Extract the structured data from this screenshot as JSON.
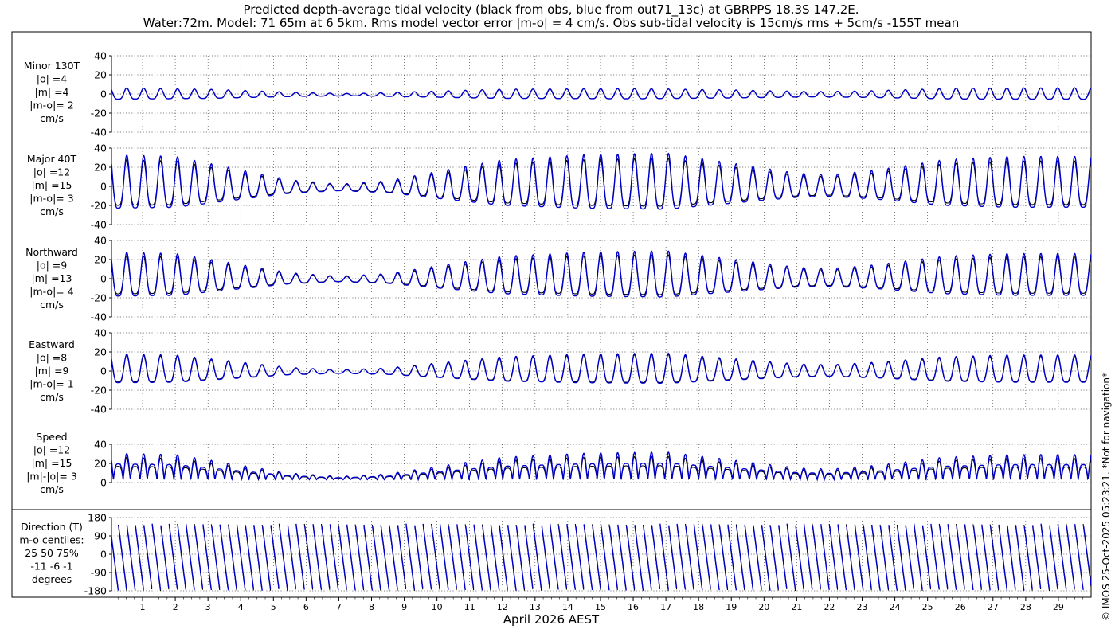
{
  "title": {
    "line1": "Predicted depth-average tidal velocity (black from obs, blue from out71_13c) at GBRPPS 18.3S 147.2E.",
    "line2": "Water:72m. Model: 71 65m at 6 5km. Rms model vector error |m-o| = 4 cm/s. Obs sub-tidal velocity is 15cm/s rms + 5cm/s -155T mean"
  },
  "xlabel": "April 2026 AEST",
  "credit": "© IMOS 25-Oct-2025 05:23:21. *Not for navigation*",
  "colors": {
    "obs": "#000000",
    "model": "#0000cc",
    "grid": "#000000"
  },
  "chart_data": {
    "type": "line",
    "x_ticks": [
      "1",
      "2",
      "3",
      "4",
      "5",
      "6",
      "7",
      "8",
      "9",
      "10",
      "11",
      "12",
      "13",
      "14",
      "15",
      "16",
      "17",
      "18",
      "19",
      "20",
      "21",
      "22",
      "23",
      "24",
      "25",
      "26",
      "27",
      "28",
      "29"
    ],
    "xlim": [
      0.05,
      30.0
    ],
    "series_legend": {
      "obs": "black from obs",
      "model": "blue from out71_13c"
    },
    "panels": [
      {
        "id": "minor",
        "label": [
          "Minor 130T",
          "|o| =4",
          "|m| =4",
          "|m-o|= 2",
          "cm/s"
        ],
        "ylim": [
          -40,
          40
        ],
        "yticks": [
          "40",
          "20",
          "0",
          "-20",
          "-40"
        ],
        "yvals": [
          40,
          20,
          0,
          -20,
          -40
        ],
        "kind": "tidal",
        "obs_amp": 6,
        "model_amp": 6,
        "offset": -1,
        "amp_envelope": [
          [
            0,
            1.0
          ],
          [
            3,
            0.8
          ],
          [
            6,
            0.3
          ],
          [
            7.5,
            0.2
          ],
          [
            9,
            0.4
          ],
          [
            12,
            0.8
          ],
          [
            16,
            0.9
          ],
          [
            19,
            0.7
          ],
          [
            21.5,
            0.45
          ],
          [
            23,
            0.55
          ],
          [
            26,
            0.95
          ],
          [
            30,
            1.0
          ]
        ]
      },
      {
        "id": "major",
        "label": [
          "Major 40T",
          "|o| =12",
          "|m| =15",
          "|m-o|= 3",
          "cm/s"
        ],
        "ylim": [
          -40,
          40
        ],
        "yticks": [
          "40",
          "20",
          "0",
          "-20",
          "-40"
        ],
        "yvals": [
          40,
          20,
          0,
          -20,
          -40
        ],
        "kind": "tidal",
        "obs_amp": 24,
        "model_amp": 28,
        "offset": -2,
        "amp_envelope": [
          [
            0,
            1.0
          ],
          [
            2,
            0.95
          ],
          [
            4,
            0.55
          ],
          [
            5.5,
            0.25
          ],
          [
            7,
            0.12
          ],
          [
            8.5,
            0.22
          ],
          [
            10,
            0.5
          ],
          [
            12,
            0.85
          ],
          [
            14.5,
            1.0
          ],
          [
            17,
            1.05
          ],
          [
            19,
            0.75
          ],
          [
            21,
            0.45
          ],
          [
            22,
            0.4
          ],
          [
            23.5,
            0.55
          ],
          [
            25.5,
            0.85
          ],
          [
            27.5,
            0.95
          ],
          [
            30,
            0.95
          ]
        ]
      },
      {
        "id": "northward",
        "label": [
          "Northward",
          "|o| =9",
          "|m| =13",
          "|m-o|= 4",
          "cm/s"
        ],
        "ylim": [
          -40,
          40
        ],
        "yticks": [
          "40",
          "20",
          "0",
          "-20",
          "-40"
        ],
        "yvals": [
          40,
          20,
          0,
          -20,
          -40
        ],
        "kind": "tidal",
        "obs_amp": 20,
        "model_amp": 23,
        "offset": -1,
        "amp_envelope": [
          [
            0,
            1.0
          ],
          [
            2,
            0.95
          ],
          [
            4,
            0.55
          ],
          [
            5.5,
            0.25
          ],
          [
            7,
            0.12
          ],
          [
            8.5,
            0.22
          ],
          [
            10,
            0.5
          ],
          [
            12,
            0.85
          ],
          [
            14.5,
            1.0
          ],
          [
            17,
            1.05
          ],
          [
            19,
            0.75
          ],
          [
            21,
            0.45
          ],
          [
            22,
            0.4
          ],
          [
            23.5,
            0.55
          ],
          [
            25.5,
            0.85
          ],
          [
            27.5,
            0.95
          ],
          [
            30,
            0.95
          ]
        ]
      },
      {
        "id": "eastward",
        "label": [
          "Eastward",
          "|o| =8",
          "|m| =9",
          "|m-o|= 1",
          "cm/s"
        ],
        "ylim": [
          -40,
          40
        ],
        "yticks": [
          "40",
          "20",
          "0",
          "-20",
          "-40"
        ],
        "yvals": [
          40,
          20,
          0,
          -20,
          -40
        ],
        "kind": "tidal",
        "obs_amp": 14,
        "model_amp": 15,
        "offset": -1,
        "amp_envelope": [
          [
            0,
            1.0
          ],
          [
            2,
            0.95
          ],
          [
            4,
            0.55
          ],
          [
            5.5,
            0.25
          ],
          [
            7,
            0.12
          ],
          [
            8.5,
            0.22
          ],
          [
            10,
            0.5
          ],
          [
            12,
            0.85
          ],
          [
            14.5,
            1.0
          ],
          [
            17,
            1.05
          ],
          [
            19,
            0.75
          ],
          [
            21,
            0.45
          ],
          [
            22,
            0.4
          ],
          [
            23.5,
            0.55
          ],
          [
            25.5,
            0.85
          ],
          [
            27.5,
            0.95
          ],
          [
            30,
            0.95
          ]
        ]
      },
      {
        "id": "speed",
        "label": [
          "Speed",
          "|o| =12",
          "|m| =15",
          "|m|-|o|= 3",
          "cm/s"
        ],
        "ylim": [
          0,
          40
        ],
        "yticks": [
          "40",
          "20",
          "0"
        ],
        "yvals": [
          40,
          20,
          0
        ],
        "kind": "speed",
        "obs_amp": 22,
        "model_amp": 26,
        "offset": 0,
        "amp_envelope": [
          [
            0,
            1.0
          ],
          [
            2,
            0.95
          ],
          [
            4,
            0.55
          ],
          [
            5.5,
            0.25
          ],
          [
            7,
            0.12
          ],
          [
            8.5,
            0.22
          ],
          [
            10,
            0.5
          ],
          [
            12,
            0.85
          ],
          [
            14.5,
            1.0
          ],
          [
            17,
            1.05
          ],
          [
            19,
            0.75
          ],
          [
            21,
            0.45
          ],
          [
            22,
            0.4
          ],
          [
            23.5,
            0.55
          ],
          [
            25.5,
            0.85
          ],
          [
            27.5,
            0.95
          ],
          [
            30,
            0.95
          ]
        ]
      },
      {
        "id": "direction",
        "label": [
          "Direction (T)",
          "m-o centiles:",
          "25  50  75%",
          "-11  -6  -1",
          "degrees"
        ],
        "ylim": [
          -180,
          180
        ],
        "yticks": [
          "180",
          "90",
          "0",
          "-90",
          "-180"
        ],
        "yvals": [
          180,
          90,
          0,
          -90,
          -180
        ],
        "kind": "direction"
      }
    ]
  }
}
